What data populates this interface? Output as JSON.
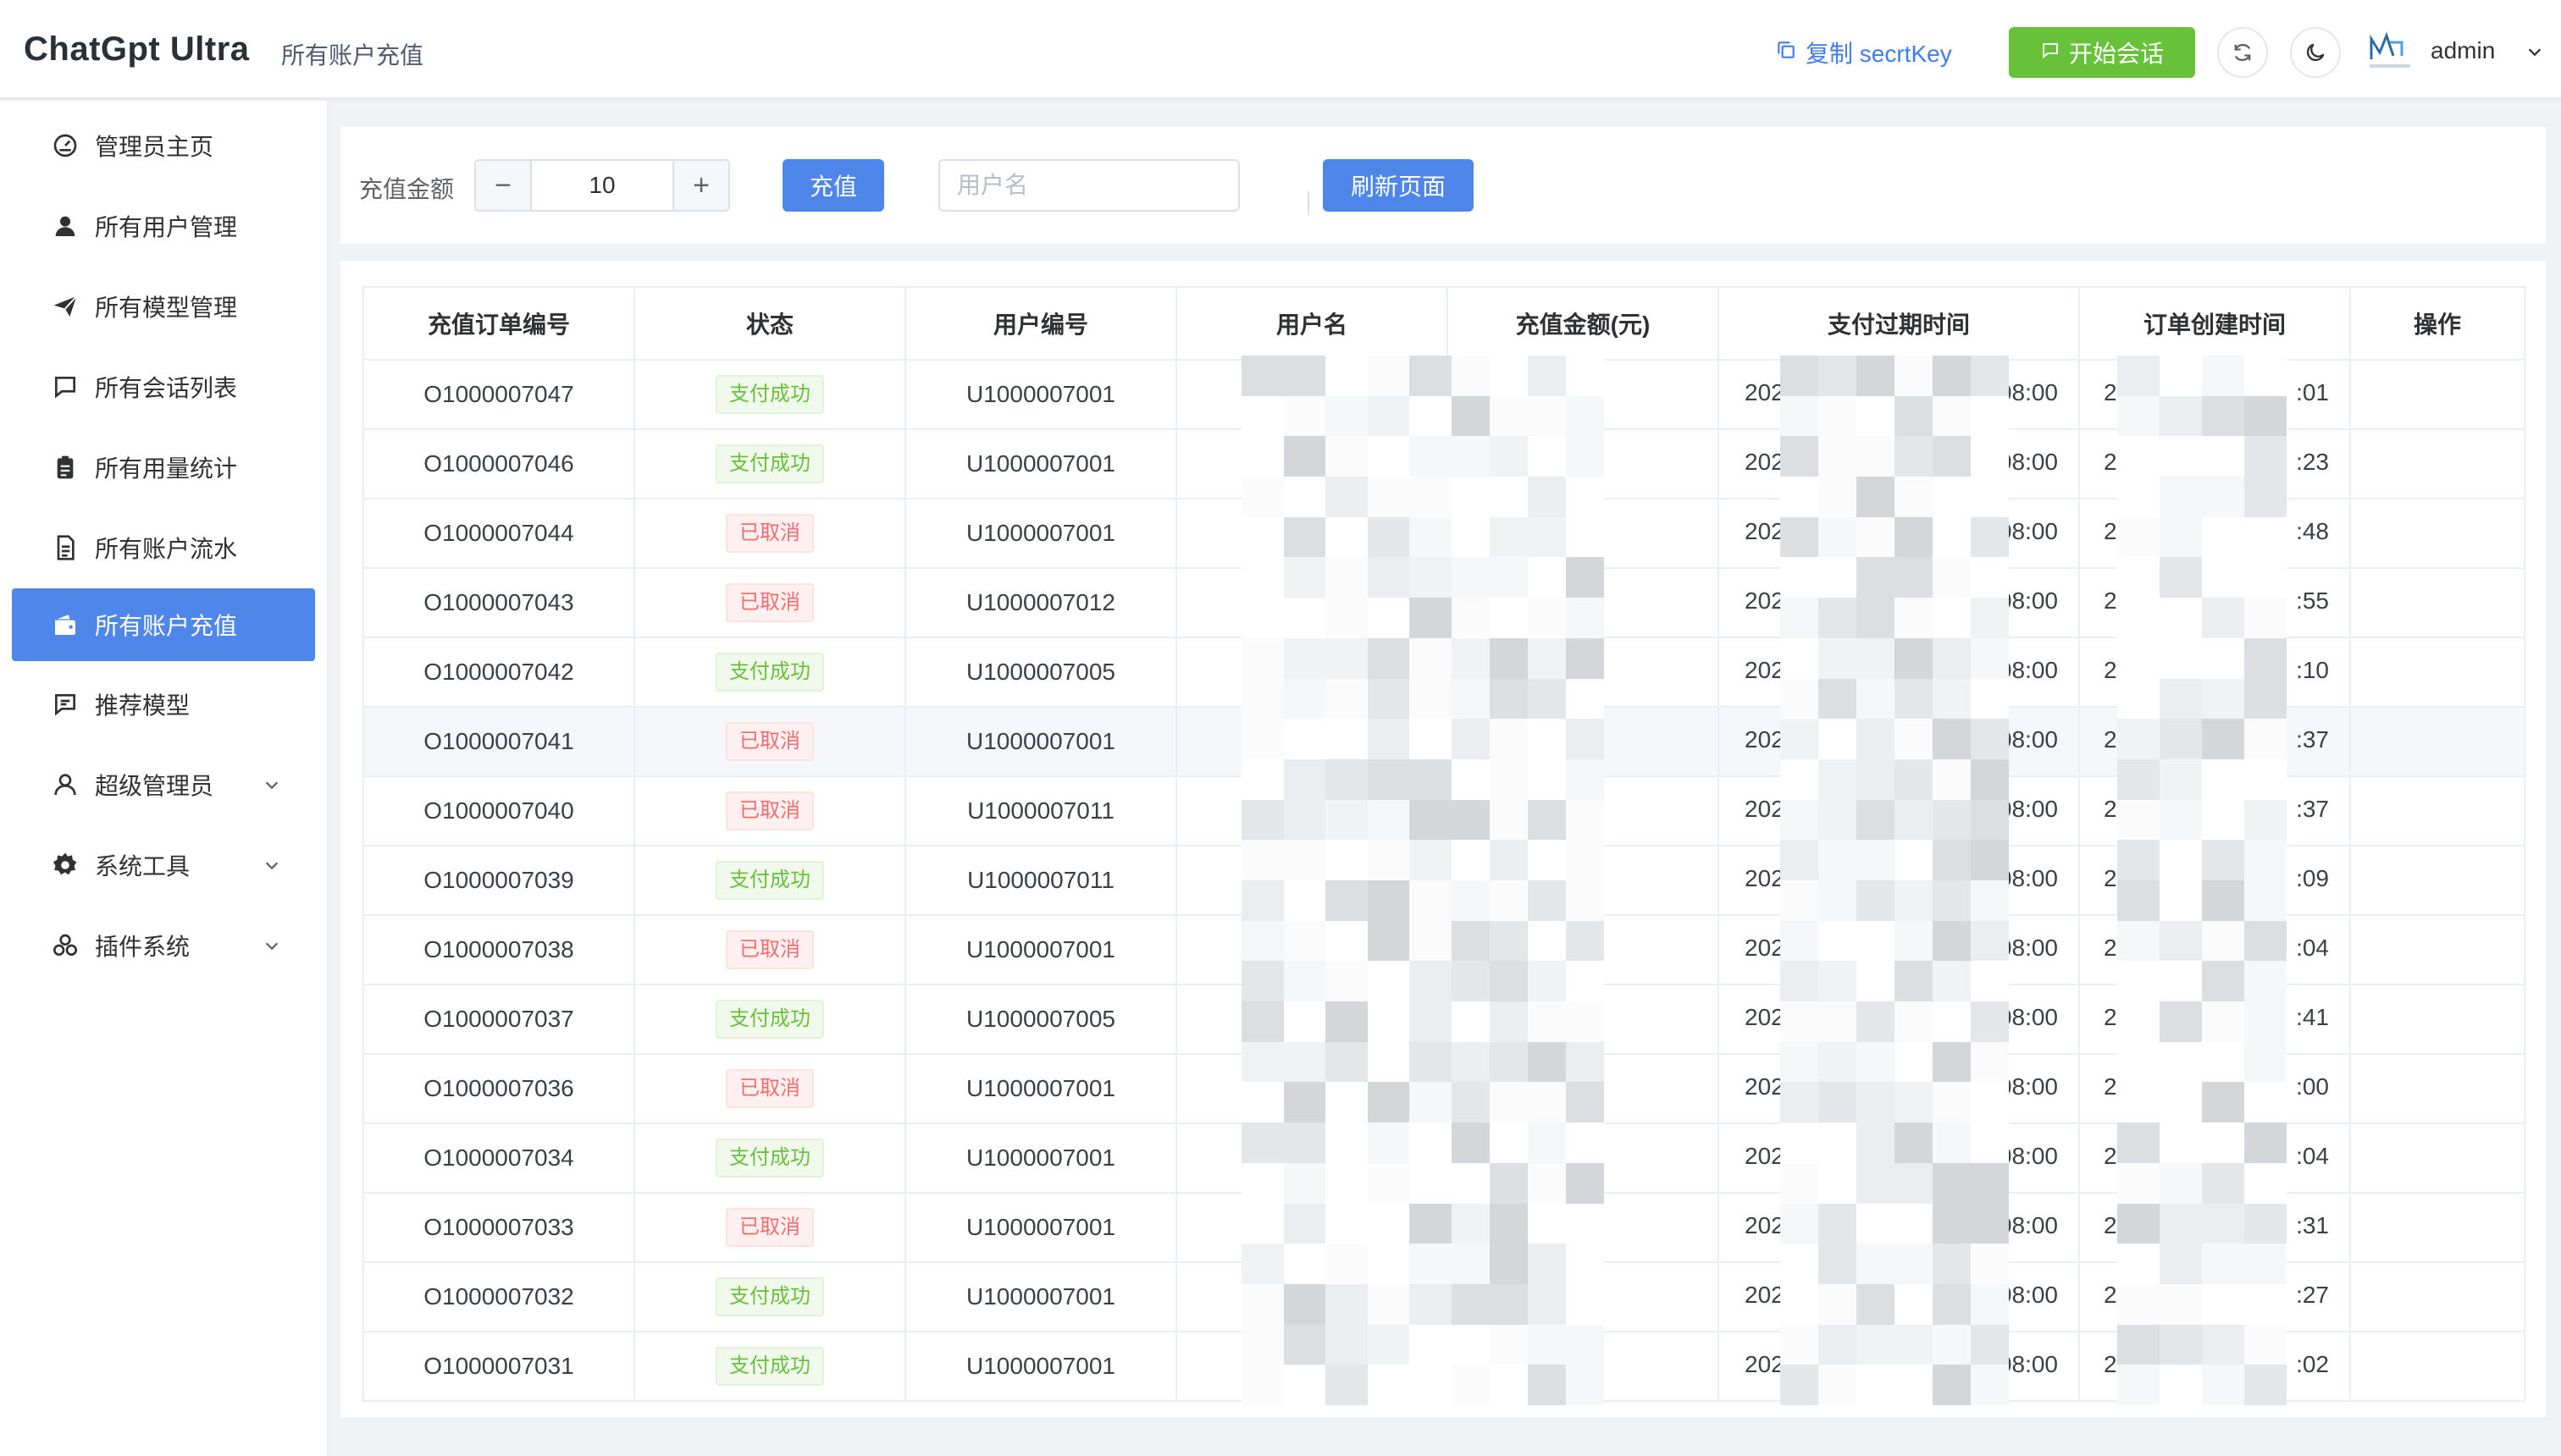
{
  "header": {
    "brand": "ChatGpt Ultra",
    "breadcrumb": "所有账户充值",
    "copy_key_label": "复制 secrtKey",
    "start_chat_label": "开始会话",
    "user_name": "admin"
  },
  "sidebar": {
    "items": [
      {
        "label": "管理员主页",
        "icon": "dashboard-icon"
      },
      {
        "label": "所有用户管理",
        "icon": "user-icon"
      },
      {
        "label": "所有模型管理",
        "icon": "send-icon"
      },
      {
        "label": "所有会话列表",
        "icon": "chat-icon"
      },
      {
        "label": "所有用量统计",
        "icon": "clipboard-icon"
      },
      {
        "label": "所有账户流水",
        "icon": "document-icon"
      },
      {
        "label": "所有账户充值",
        "icon": "wallet-icon",
        "active": true
      },
      {
        "label": "推荐模型",
        "icon": "message-icon"
      },
      {
        "label": "超级管理员",
        "icon": "person-icon",
        "expandable": true
      },
      {
        "label": "系统工具",
        "icon": "settings-icon",
        "expandable": true
      },
      {
        "label": "插件系统",
        "icon": "plugin-icon",
        "expandable": true
      }
    ]
  },
  "filter": {
    "amount_label": "充值金额",
    "amount_value": "10",
    "recharge_button": "充值",
    "username_placeholder": "用户名",
    "refresh_button": "刷新页面"
  },
  "table": {
    "columns": [
      "充值订单编号",
      "状态",
      "用户编号",
      "用户名",
      "充值金额(元)",
      "支付过期时间",
      "订单创建时间",
      "操作"
    ],
    "rows": [
      {
        "order": "O1000007047",
        "status": "支付成功",
        "status_type": "ok",
        "user_id": "U1000007001",
        "expire_prefix": "202",
        "expire_suffix": "08:00",
        "created_prefix": "20",
        "created_suffix": ":01"
      },
      {
        "order": "O1000007046",
        "status": "支付成功",
        "status_type": "ok",
        "user_id": "U1000007001",
        "expire_prefix": "202",
        "expire_suffix": "08:00",
        "created_prefix": "20",
        "created_suffix": ":23"
      },
      {
        "order": "O1000007044",
        "status": "已取消",
        "status_type": "cancel",
        "user_id": "U1000007001",
        "expire_prefix": "202",
        "expire_suffix": "08:00",
        "created_prefix": "20",
        "created_suffix": ":48"
      },
      {
        "order": "O1000007043",
        "status": "已取消",
        "status_type": "cancel",
        "user_id": "U1000007012",
        "expire_prefix": "202",
        "expire_suffix": "08:00",
        "created_prefix": "20",
        "created_suffix": ":55"
      },
      {
        "order": "O1000007042",
        "status": "支付成功",
        "status_type": "ok",
        "user_id": "U1000007005",
        "expire_prefix": "202",
        "expire_suffix": "08:00",
        "created_prefix": "20",
        "created_suffix": ":10"
      },
      {
        "order": "O1000007041",
        "status": "已取消",
        "status_type": "cancel",
        "user_id": "U1000007001",
        "expire_prefix": "202",
        "expire_suffix": "08:00",
        "created_prefix": "20",
        "created_suffix": ":37"
      },
      {
        "order": "O1000007040",
        "status": "已取消",
        "status_type": "cancel",
        "user_id": "U1000007011",
        "expire_prefix": "202",
        "expire_suffix": "08:00",
        "created_prefix": "20",
        "created_suffix": ":37"
      },
      {
        "order": "O1000007039",
        "status": "支付成功",
        "status_type": "ok",
        "user_id": "U1000007011",
        "expire_prefix": "202",
        "expire_suffix": "08:00",
        "created_prefix": "20",
        "created_suffix": ":09"
      },
      {
        "order": "O1000007038",
        "status": "已取消",
        "status_type": "cancel",
        "user_id": "U1000007001",
        "expire_prefix": "202",
        "expire_suffix": "08:00",
        "created_prefix": "20",
        "created_suffix": ":04"
      },
      {
        "order": "O1000007037",
        "status": "支付成功",
        "status_type": "ok",
        "user_id": "U1000007005",
        "expire_prefix": "202",
        "expire_suffix": "08:00",
        "created_prefix": "20",
        "created_suffix": ":41"
      },
      {
        "order": "O1000007036",
        "status": "已取消",
        "status_type": "cancel",
        "user_id": "U1000007001",
        "expire_prefix": "202",
        "expire_suffix": "08:00",
        "created_prefix": "20",
        "created_suffix": ":00"
      },
      {
        "order": "O1000007034",
        "status": "支付成功",
        "status_type": "ok",
        "user_id": "U1000007001",
        "expire_prefix": "202",
        "expire_suffix": "08:00",
        "created_prefix": "20",
        "created_suffix": ":04"
      },
      {
        "order": "O1000007033",
        "status": "已取消",
        "status_type": "cancel",
        "user_id": "U1000007001",
        "expire_prefix": "202",
        "expire_suffix": "08:00",
        "created_prefix": "20",
        "created_suffix": ":31"
      },
      {
        "order": "O1000007032",
        "status": "支付成功",
        "status_type": "ok",
        "user_id": "U1000007001",
        "expire_prefix": "202",
        "expire_suffix": "08:00",
        "created_prefix": "20",
        "created_suffix": ":27"
      },
      {
        "order": "O1000007031",
        "status": "支付成功",
        "status_type": "ok",
        "user_id": "U1000007001",
        "expire_prefix": "202",
        "expire_suffix": "08:00",
        "created_prefix": "20",
        "created_suffix": ":02"
      }
    ]
  },
  "colors": {
    "primary": "#4e86ea",
    "success": "#67c23a",
    "danger": "#f56c6c",
    "link": "#3f7cf0"
  }
}
